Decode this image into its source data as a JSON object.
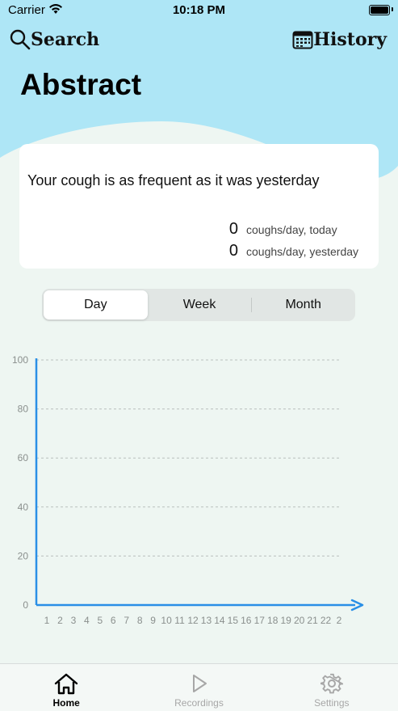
{
  "status_bar": {
    "carrier": "Carrier",
    "time": "10:18 PM"
  },
  "nav": {
    "search_label": "Search",
    "history_label": "History"
  },
  "page_title": "Abstract",
  "summary": {
    "message": "Your cough is as frequent as it was yesterday",
    "today_value": "0",
    "today_label": "coughs/day, today",
    "yesterday_value": "0",
    "yesterday_label": "coughs/day, yesterday"
  },
  "segments": {
    "selected": "Day",
    "day": "Day",
    "week": "Week",
    "month": "Month"
  },
  "colors": {
    "wave": "#aee6f6",
    "axis": "#2a8fe6",
    "grid": "#b9c0bd",
    "page": "#eef6f2"
  },
  "chart_data": {
    "type": "line",
    "ylim": [
      0,
      100
    ],
    "y_ticks": [
      0,
      20,
      40,
      60,
      80,
      100
    ],
    "x_ticks": [
      "1",
      "2",
      "3",
      "4",
      "5",
      "6",
      "7",
      "8",
      "9",
      "10",
      "11",
      "12",
      "13",
      "14",
      "15",
      "16",
      "17",
      "18",
      "19",
      "20",
      "21",
      "22",
      "2"
    ],
    "series": [],
    "grid": true
  },
  "tab_bar": {
    "home": {
      "label": "Home",
      "icon": "house-icon"
    },
    "recordings": {
      "label": "Recordings",
      "icon": "play-icon"
    },
    "settings": {
      "label": "Settings",
      "icon": "gear-icon"
    }
  }
}
